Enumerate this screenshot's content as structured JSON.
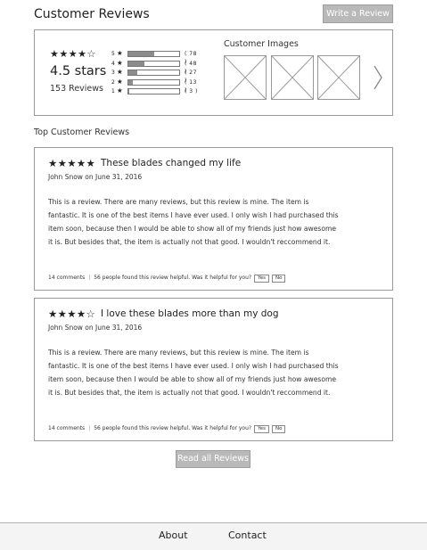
{
  "header": {
    "title": "Customer Reviews",
    "write_review_label": "Write a Review"
  },
  "summary": {
    "stars": "★★★★☆",
    "rating_text": "4.5 stars",
    "count_text": "153 Reviews",
    "histogram": [
      {
        "label": "5",
        "count": "( 78 )",
        "fraction": 0.51
      },
      {
        "label": "4",
        "count": "( 48 )",
        "fraction": 0.31
      },
      {
        "label": "3",
        "count": "( 27 )",
        "fraction": 0.18
      },
      {
        "label": "2",
        "count": "( 13 )",
        "fraction": 0.085
      },
      {
        "label": "1",
        "count": "( 3 )",
        "fraction": 0.02
      }
    ],
    "images_label": "Customer Images",
    "image_count": 3
  },
  "section_title": "Top Customer Reviews",
  "reviews": [
    {
      "stars": "★★★★★",
      "title": "These blades changed my life",
      "author": "John Snow on June 31, 2016",
      "body": "This is a review. There are many reviews, but this review is mine. The item is fantastic. It is one of the best items I have ever used. I only wish I had purchased this item soon, because then I would be able to show all of my friends just how awesome it is. But besides that, the item is actually not that good. I wouldn't reccommend it.",
      "comments": "14 comments",
      "helpful": "56 people found this review helpful. Was it helpful for you?",
      "yes": "Yes",
      "no": "No"
    },
    {
      "stars": "★★★★☆",
      "title": "I love these blades more than my dog",
      "author": "John Snow on June 31, 2016",
      "body": "This is a review. There are many reviews, but this review is mine. The item is fantastic. It is one of the best items I have ever used. I only wish I had purchased this item soon, because then I would be able to show all of my friends just how awesome it is. But besides that, the item is actually not that good. I wouldn't reccommend it.",
      "comments": "14 comments",
      "helpful": "56 people found this review helpful. Was it helpful for you?",
      "yes": "Yes",
      "no": "No"
    }
  ],
  "read_all_label": "Read all Reviews",
  "footer": {
    "about": "About",
    "contact": "Contact"
  }
}
